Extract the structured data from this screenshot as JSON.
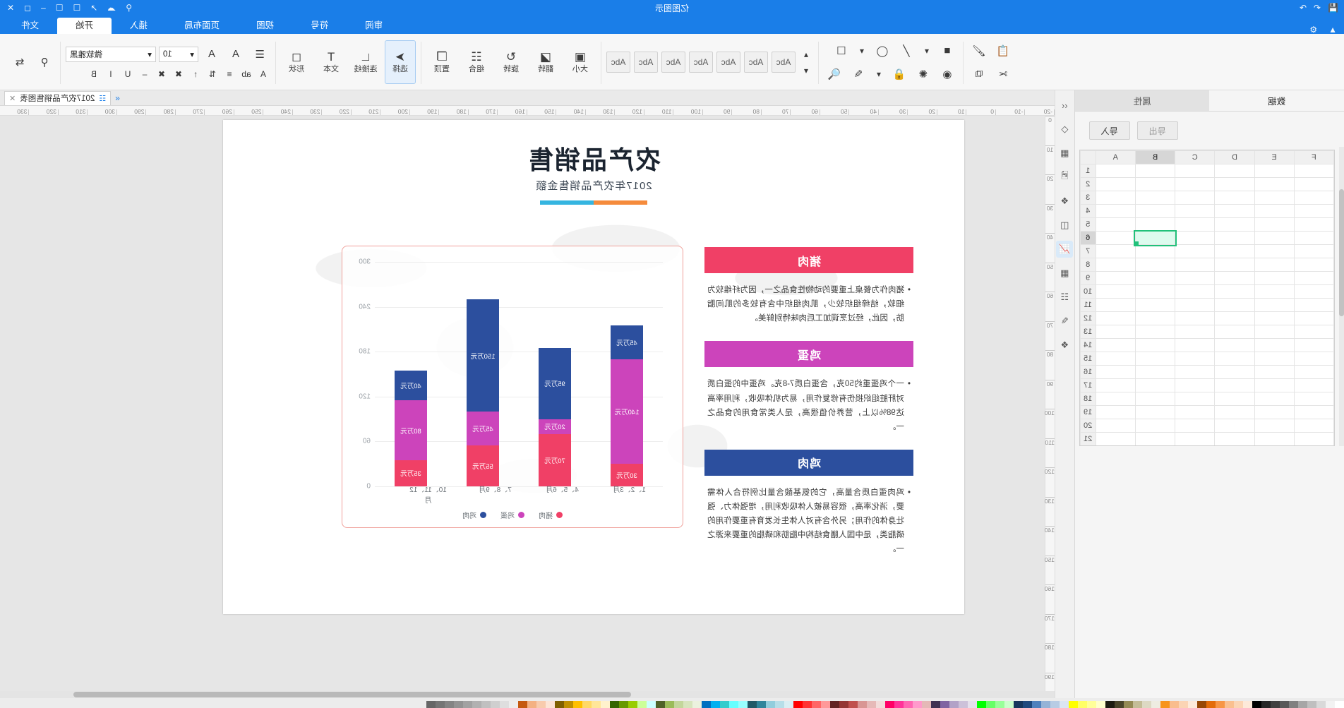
{
  "titlebar": {
    "app_title": "亿图图示",
    "left_icons": [
      "save-icon",
      "undo-icon",
      "redo-icon"
    ],
    "right_icons": [
      "search-icon",
      "cloud-icon",
      "share-icon",
      "comment-icon",
      "help-icon",
      "minimize-icon",
      "maximize-icon",
      "close-icon"
    ]
  },
  "ribbon": {
    "tabs": [
      {
        "label": "文件",
        "active": false
      },
      {
        "label": "开始",
        "active": true
      },
      {
        "label": "插入",
        "active": false
      },
      {
        "label": "页面布局",
        "active": false
      },
      {
        "label": "视图",
        "active": false
      },
      {
        "label": "符号",
        "active": false
      },
      {
        "label": "审阅",
        "active": false
      }
    ],
    "font": {
      "family_value": "微软雅黑",
      "size_value": "10"
    },
    "groups": {
      "clipboard": [
        "paste-icon",
        "cut-icon",
        "copy-icon",
        "format-painter-icon"
      ],
      "font_buttons": [
        "bold-icon",
        "italic-icon",
        "underline-icon",
        "strikethrough-icon",
        "superscript-icon",
        "subscript-icon",
        "font-color-icon",
        "highlight-icon",
        "clear-format-icon"
      ],
      "paragraph_buttons": [
        "align-left-icon",
        "align-center-icon",
        "align-right-icon",
        "justify-icon",
        "line-spacing-icon",
        "bullets-icon",
        "numbering-icon",
        "indent-icon",
        "outdent-icon"
      ],
      "tools": [
        {
          "label": "选择",
          "icon": "pointer-icon",
          "selected": true
        },
        {
          "label": "连接线",
          "icon": "connector-icon",
          "selected": false
        },
        {
          "label": "文本",
          "icon": "text-icon",
          "selected": false
        },
        {
          "label": "形状",
          "icon": "shape-icon",
          "selected": false
        }
      ],
      "arrange": [
        {
          "label": "大小",
          "icon": "size-icon"
        },
        {
          "label": "翻转",
          "icon": "flip-icon"
        },
        {
          "label": "旋转",
          "icon": "rotate-icon"
        },
        {
          "label": "组合",
          "icon": "group-icon"
        },
        {
          "label": "置顶",
          "icon": "bring-front-icon"
        }
      ],
      "styles": [
        "Abc",
        "Abc",
        "Abc",
        "Abc",
        "Abc",
        "Abc",
        "Abc"
      ],
      "shape_tools": [
        "fill-icon",
        "line-icon",
        "shadow-icon",
        "effect-icon",
        "theme-icon",
        "lock-icon",
        "crop-icon",
        "eyedropper-icon",
        "zoom-icon"
      ],
      "right_tools": [
        "find-icon",
        "replace-icon"
      ]
    }
  },
  "data_panel": {
    "tabs": [
      {
        "label": "属性",
        "active": false
      },
      {
        "label": "数据",
        "active": true
      }
    ],
    "buttons": [
      {
        "label": "导入",
        "enabled": true
      },
      {
        "label": "导出",
        "enabled": false
      }
    ],
    "sheet": {
      "columns": [
        "A",
        "B",
        "C",
        "D",
        "E",
        "F"
      ],
      "selected_column": "B",
      "selected_cell": "B6",
      "rows": [
        "1",
        "2",
        "3",
        "4",
        "5",
        "6",
        "7",
        "8",
        "9",
        "10",
        "11",
        "12",
        "13",
        "14",
        "15",
        "16",
        "17",
        "18",
        "19",
        "20",
        "21"
      ]
    }
  },
  "tool_rail": {
    "items": [
      {
        "icon": "shapes-icon",
        "selected": false
      },
      {
        "icon": "grid-icon",
        "selected": false
      },
      {
        "icon": "image-icon",
        "selected": false
      },
      {
        "icon": "layers-icon",
        "selected": false
      },
      {
        "icon": "container-icon",
        "selected": false
      },
      {
        "icon": "chart-icon",
        "selected": true
      },
      {
        "icon": "table-icon",
        "selected": false
      },
      {
        "icon": "gallery-icon",
        "selected": false
      },
      {
        "icon": "note-icon",
        "selected": false
      },
      {
        "icon": "shuffle-icon",
        "selected": false
      }
    ],
    "collapse_icon": "chevron-left-icon"
  },
  "document_tab": {
    "label": "2017农产品销售图表",
    "close_icon": "close-icon",
    "doc_icon": "document-icon",
    "expand_icon": "double-chevron-icon"
  },
  "rulers": {
    "h_ticks": [
      "330",
      "320",
      "310",
      "300",
      "290",
      "280",
      "270",
      "260",
      "250",
      "240",
      "230",
      "220",
      "210",
      "200",
      "190",
      "180",
      "170",
      "160",
      "150",
      "140",
      "130",
      "120",
      "110",
      "100",
      "90",
      "80",
      "70",
      "60",
      "50",
      "40",
      "30",
      "20",
      "10",
      "0",
      "-10",
      "-20"
    ],
    "v_ticks": [
      "0",
      "10",
      "20",
      "30",
      "40",
      "50",
      "60",
      "70",
      "80",
      "90",
      "100",
      "110",
      "120",
      "130",
      "140",
      "150",
      "160",
      "170",
      "180",
      "190"
    ]
  },
  "slide": {
    "title": "农产品销售",
    "subtitle": "2017年农产品销售金额",
    "rule_colors": [
      "#f58b3c",
      "#35b5e0"
    ],
    "cards": [
      {
        "heading": "猪肉",
        "color": "#f04066",
        "text": "猪肉作为餐桌上重要的动物性食品之一，因为纤维较为细软，结缔组织较少，肌肉组织中含有较多的肌间脂肪，因此，经过烹调加工后肉味特别鲜美。"
      },
      {
        "heading": "鸡蛋",
        "color": "#cc44bb",
        "text": "一个鸡蛋重约50克，含蛋白质7-8克。鸡蛋中的蛋白质对肝脏组织损伤有修复作用，易为机体吸收，利用率高达98%以上，营养价值很高，是人类常食用的食品之一。"
      },
      {
        "heading": "鸡肉",
        "color": "#2c4f9e",
        "text": "鸡肉蛋白质含量高，它的氨基酸含量比例符合人体需要，消化率高，很容易被人体吸收利用，增强体力、强壮身体的作用；另外含有对人体生长发育有重要作用的磷脂类，是中国人膳食结构中脂肪和磷脂的重要来源之一。"
      }
    ]
  },
  "chart_data": {
    "type": "bar",
    "stacked": true,
    "title": "",
    "xlabel": "",
    "ylabel": "",
    "categories": [
      "1、2、3月",
      "4、5、6月",
      "7、8、9月",
      "10、11、12月"
    ],
    "series": [
      {
        "name": "猪肉",
        "color": "#f04066",
        "values": [
          30,
          70,
          55,
          35
        ],
        "labels": [
          "30万元",
          "70万元",
          "55万元",
          "35万元"
        ]
      },
      {
        "name": "鸡蛋",
        "color": "#cc44bb",
        "values": [
          140,
          20,
          45,
          80
        ],
        "labels": [
          "140万元",
          "20万元",
          "45万元",
          "80万元"
        ]
      },
      {
        "name": "鸡肉",
        "color": "#2c4f9e",
        "values": [
          45,
          95,
          150,
          40
        ],
        "labels": [
          "45万元",
          "95万元",
          "150万元",
          "40万元"
        ]
      }
    ],
    "yticks": [
      "0",
      "60",
      "120",
      "180",
      "240",
      "300"
    ],
    "ylim": [
      0,
      300
    ],
    "grid": true,
    "legend_position": "bottom",
    "legend": [
      "猪肉",
      "鸡蛋",
      "鸡肉"
    ]
  },
  "colorbar": {
    "colors": [
      "#ffffff",
      "#f2f2f2",
      "#d9d9d9",
      "#bfbfbf",
      "#a6a6a6",
      "#808080",
      "#595959",
      "#404040",
      "#262626",
      "#000000",
      "#fde9d9",
      "#fbd5b5",
      "#fac090",
      "#f79646",
      "#e36c0a",
      "#974806",
      "#fdeada",
      "#fbd4b4",
      "#f9bd8e",
      "#f7941d",
      "#eeece1",
      "#ddd9c3",
      "#c4bd97",
      "#948a54",
      "#494429",
      "#1d1b10",
      "#ffffcc",
      "#ffff99",
      "#ffff66",
      "#ffff00",
      "#dbe5f1",
      "#b8cce4",
      "#95b3d7",
      "#4f81bd",
      "#1f497d",
      "#16365c",
      "#ccffcc",
      "#99ff99",
      "#66ff66",
      "#00ff00",
      "#e5e0ec",
      "#ccc1d9",
      "#b2a2c7",
      "#8064a2",
      "#403152",
      "#e5b8b7",
      "#ff99cc",
      "#ff66b2",
      "#ff3399",
      "#ff0066",
      "#f2dcdb",
      "#e6b9b8",
      "#d99694",
      "#c0504d",
      "#943634",
      "#632423",
      "#ff9999",
      "#ff6666",
      "#ff3333",
      "#ff0000",
      "#daeef3",
      "#b7dee8",
      "#92cddc",
      "#31859b",
      "#215967",
      "#99ffff",
      "#66ffff",
      "#33cccc",
      "#00b0f0",
      "#0070c0",
      "#ebf1de",
      "#d7e4bd",
      "#c3d69b",
      "#9bbb59",
      "#4f6228",
      "#ccffff",
      "#ccff99",
      "#99cc00",
      "#669900",
      "#336600",
      "#fff2cc",
      "#ffe699",
      "#ffd966",
      "#ffc000",
      "#bf9000",
      "#7f6000",
      "#fce4d6",
      "#f8cbad",
      "#f4b183",
      "#c55a11",
      "#ededed",
      "#dedede",
      "#cfcfcf",
      "#c0c0c0",
      "#b1b1b1",
      "#a2a2a2",
      "#939393",
      "#848484",
      "#757575",
      "#666666"
    ]
  }
}
